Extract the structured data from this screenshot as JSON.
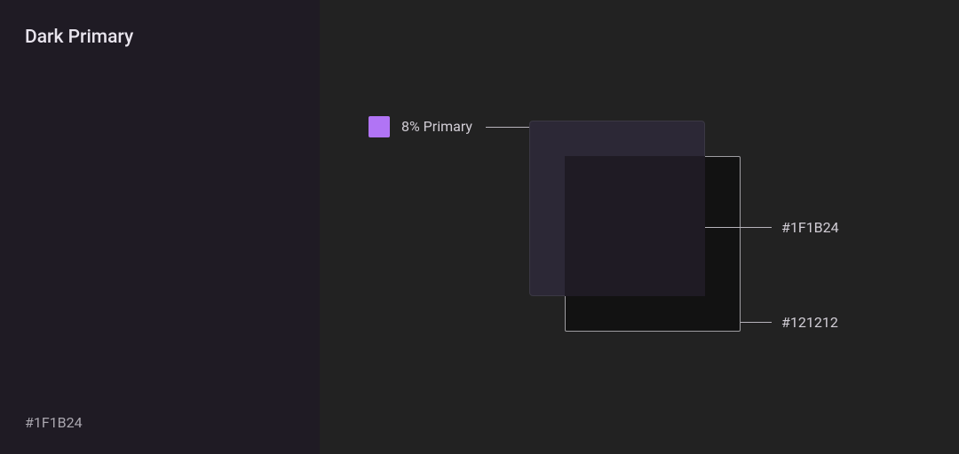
{
  "sidebar": {
    "title": "Dark Primary",
    "hex": "#1F1B24",
    "bg_color": "#1F1B24"
  },
  "main": {
    "bg_color": "#222222",
    "primary_swatch_color": "#B174F5",
    "overlay_label": "8% Primary",
    "overlay_layer": {
      "color": "#2C2836",
      "border_color": "#3B3844"
    },
    "result_layer": {
      "color": "#1F1B24",
      "label": "#1F1B24",
      "border_color": "#9E9DA1"
    },
    "base_layer": {
      "color": "#121212",
      "label": "#121212",
      "border_color": "#9E9DA1"
    }
  }
}
